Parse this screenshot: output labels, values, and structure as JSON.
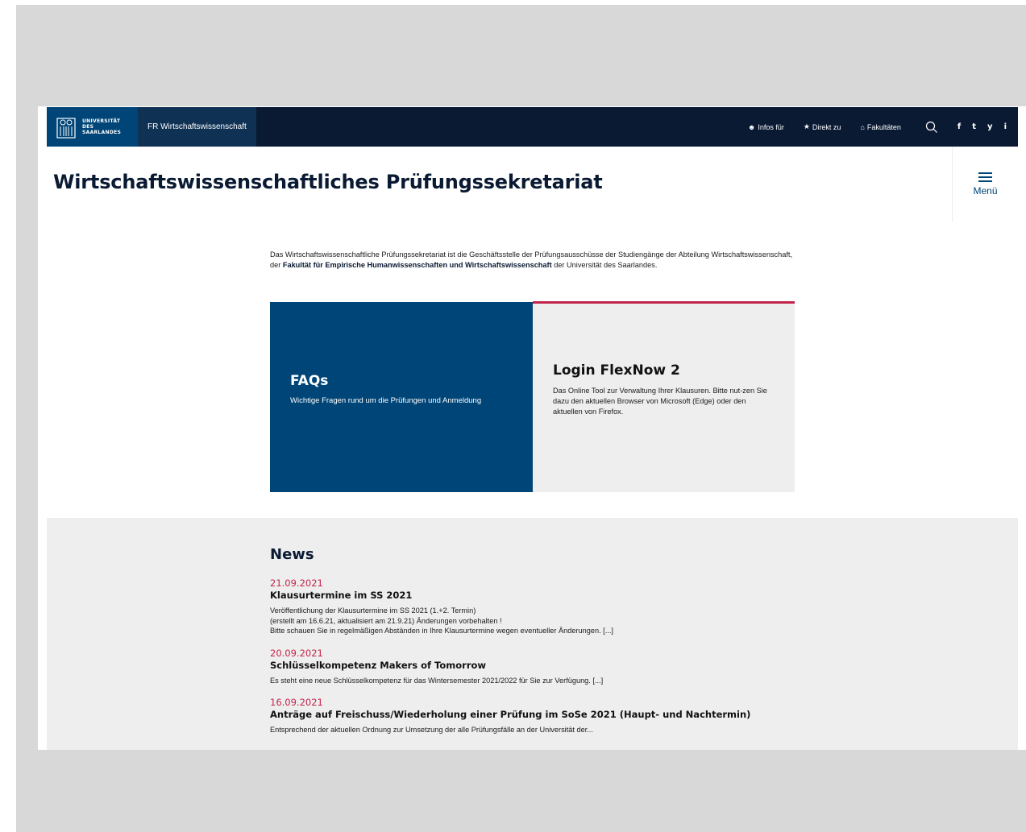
{
  "brand": {
    "university_lines": [
      "UNIVERSITÄT",
      "DES",
      "SAARLANDES"
    ],
    "site_name": "FR Wirtschaftswissenschaft"
  },
  "nav": {
    "items": [
      {
        "icon": "user-icon",
        "label": "Infos für"
      },
      {
        "icon": "star-icon",
        "label": "Direkt zu"
      },
      {
        "icon": "building-icon",
        "label": "Fakultäten"
      }
    ],
    "social": [
      "f",
      "t",
      "y",
      "i"
    ]
  },
  "header": {
    "title": "Wirtschaftswissenschaftliches Prüfungssekretariat",
    "menu_label": "Menü"
  },
  "intro": {
    "text_before": "Das Wirtschaftswissenschaftliche Prüfungssekretariat ist die Geschäftsstelle der Prüfungsausschüsse der Studiengänge der Abteilung Wirtschaftswissenschaft, der ",
    "bold": "Fakultät für Empirische Humanwissenschaften und Wirtschaftswissenschaft",
    "text_after": " der Universität des Saarlandes."
  },
  "teasers": {
    "faq": {
      "title": "FAQs",
      "text": "Wichtige Fragen rund um die Prüfungen und Anmeldung"
    },
    "login": {
      "title": "Login FlexNow 2",
      "text": "Das Online Tool zur Verwaltung Ihrer Klausuren. Bitte nut-zen Sie dazu den aktuellen Browser von Microsoft (Edge) oder den aktuellen von Firefox."
    }
  },
  "news": {
    "heading": "News",
    "items": [
      {
        "date": "21.09.2021",
        "title": "Klausurtermine im SS 2021",
        "lines": [
          "Veröffentlichung der Klausurtermine im SS 2021 (1.+2. Termin)",
          "(erstellt am 16.6.21, aktualisiert am 21.9.21) Änderungen vorbehalten !",
          "Bitte schauen Sie in regelmäßigen Abständen in Ihre Klausurtermine wegen eventueller Änderungen. [...]"
        ]
      },
      {
        "date": "20.09.2021",
        "title": "Schlüsselkompetenz Makers of Tomorrow",
        "lines": [
          "Es steht eine neue Schlüsselkompetenz für das Wintersemester 2021/2022 für Sie zur Verfügung. [...]"
        ]
      },
      {
        "date": "16.09.2021",
        "title": "Anträge auf Freischuss/Wiederholung einer Prüfung im SoSe 2021 (Haupt- und Nachtermin)",
        "lines": [
          "Entsprechend der aktuellen Ordnung zur Umsetzung der alle Prüfungsfälle an der Universität der..."
        ]
      }
    ]
  },
  "colors": {
    "navy": "#0a1a33",
    "brand_blue": "#004577",
    "accent": "#c3244b"
  }
}
